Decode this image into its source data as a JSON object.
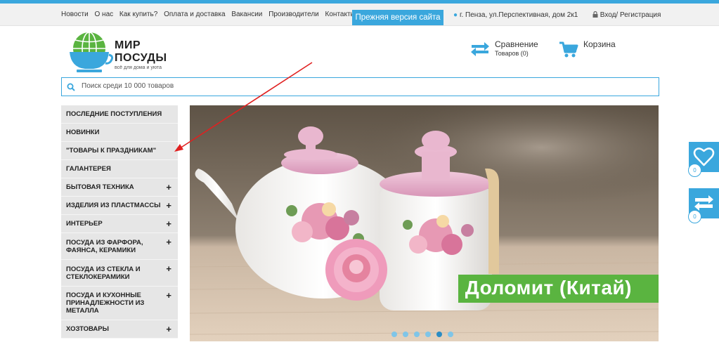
{
  "topnav": {
    "links": [
      "Новости",
      "О нас",
      "Как купить?",
      "Оплата и доставка",
      "Вакансии",
      "Производители",
      "Контакты"
    ],
    "old_site_button": "Прежняя версия сайта",
    "address": "г. Пенза, ул.Перспективная, дом 2к1",
    "login": "Вход/ Регистрация"
  },
  "logo": {
    "line1": "МИР",
    "line2": "ПОСУДЫ",
    "tagline": "всё для дома и уюта"
  },
  "compare": {
    "title": "Сравнение",
    "subtitle": "Товаров (0)"
  },
  "cart": {
    "title": "Корзина"
  },
  "search": {
    "placeholder": "Поиск среди 10 000 товаров"
  },
  "sidebar": {
    "items": [
      {
        "label": "ПОСЛЕДНИЕ ПОСТУПЛЕНИЯ",
        "expandable": false
      },
      {
        "label": "НОВИНКИ",
        "expandable": false
      },
      {
        "label": "\"ТОВАРЫ К ПРАЗДНИКАМ\"",
        "expandable": false
      },
      {
        "label": "ГАЛАНТЕРЕЯ",
        "expandable": false
      },
      {
        "label": "БЫТОВАЯ ТЕХНИКА",
        "expandable": true
      },
      {
        "label": "ИЗДЕЛИЯ ИЗ ПЛАСТМАССЫ",
        "expandable": true
      },
      {
        "label": "ИНТЕРЬЕР",
        "expandable": true
      },
      {
        "label": "ПОСУДА ИЗ ФАРФОРА, ФАЯНСА, КЕРАМИКИ",
        "expandable": true
      },
      {
        "label": "ПОСУДА ИЗ СТЕКЛА И СТЕКЛОКЕРАМИКИ",
        "expandable": true
      },
      {
        "label": "ПОСУДА И КУХОННЫЕ ПРИНАДЛЕЖНОСТИ ИЗ МЕТАЛЛА",
        "expandable": true
      },
      {
        "label": "ХОЗТОВАРЫ",
        "expandable": true
      }
    ],
    "expand_symbol": "+"
  },
  "banner": {
    "label": "Доломит (Китай)",
    "slide_count": 6,
    "active_slide": 5
  },
  "side_widgets": {
    "favorites_count": "0",
    "compare_count": "0"
  },
  "colors": {
    "accent": "#3aa7dd",
    "banner_label": "#5ab440",
    "sidebar_bg": "#e6e6e6",
    "annotation_arrow": "#e02020"
  }
}
